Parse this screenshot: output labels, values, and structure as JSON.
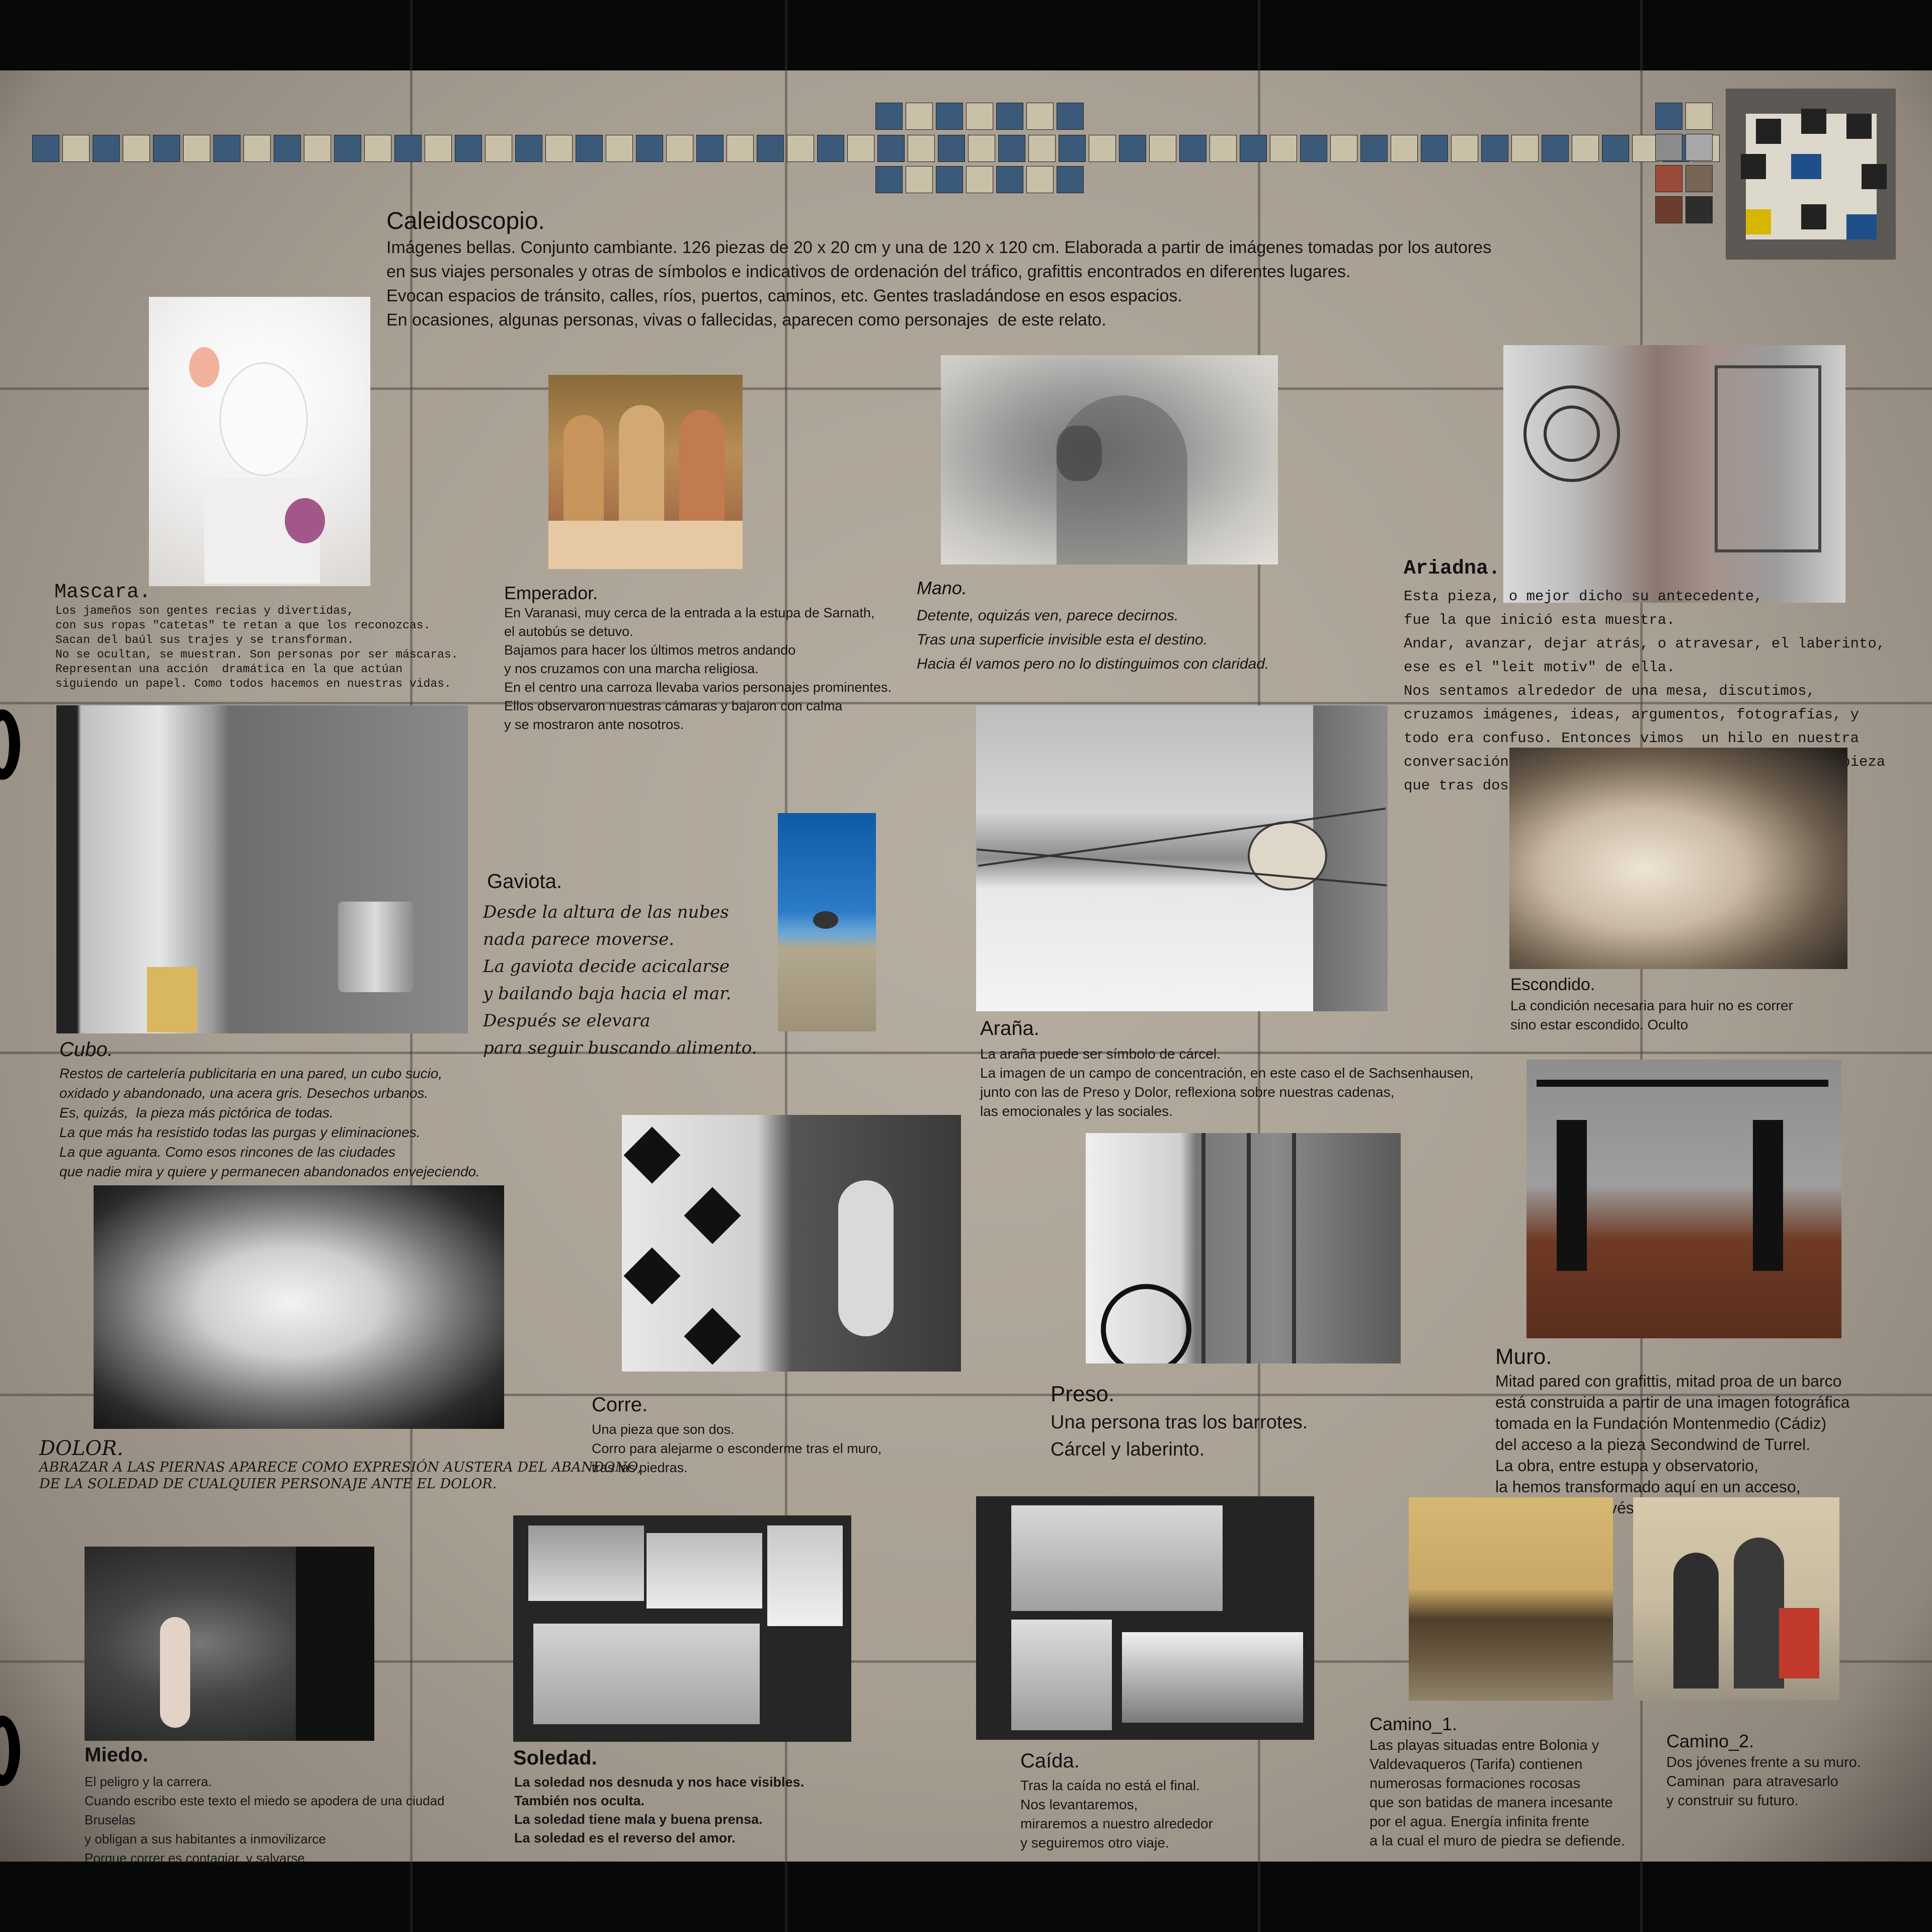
{
  "caleidoscopio": {
    "title": "Caleidoscopio.",
    "lines": [
      "Imágenes bellas. Conjunto cambiante. 126 piezas de 20 x 20 cm y una de 120 x 120 cm. Elaborada a partir de imágenes tomadas por los autores",
      "en sus viajes personales y otras de símbolos e indicativos de ordenación del tráfico, grafittis encontrados en diferentes lugares.",
      "Evocan espacios de tránsito, calles, ríos, puertos, caminos, etc. Gentes trasladándose en esos espacios.",
      "En ocasiones, algunas personas, vivas o fallecidas, aparecen como personajes  de este relato."
    ]
  },
  "mascara": {
    "title": "Mascara.",
    "text": "Los jameños son gentes recias y divertidas,\ncon sus ropas \"catetas\" te retan a que los reconozcas.\nSacan del baúl sus trajes y se transforman.\nNo se ocultan, se muestran. Son personas por ser máscaras.\nRepresentan una acción  dramática en la que actúan\nsiguiendo un papel. Como todos hacemos en nuestras vidas."
  },
  "emperador": {
    "title": "Emperador.",
    "text": "En Varanasi, muy cerca de la entrada a la estupa de Sarnath,\nel autobús se detuvo.\nBajamos para hacer los últimos metros andando\ny nos cruzamos con una marcha religiosa.\nEn el centro una carroza llevaba varios personajes prominentes.\nEllos observaron nuestras cámaras y bajaron con calma\ny se mostraron ante nosotros."
  },
  "mano": {
    "title": "Mano.",
    "text": "Detente, oquizás ven, parece decirnos.\nTras una superficie invisible esta el destino.\nHacia él vamos pero no lo distinguimos con claridad."
  },
  "ariadna": {
    "title": "Ariadna.",
    "text": "Esta pieza, o mejor dicho su antecedente,\nfue la que inició esta muestra.\nAndar, avanzar, dejar atrás, o atravesar, el laberinto,\nese es el \"leit motiv\" de ella.\nNos sentamos alrededor de una mesa, discutimos,\ncruzamos imágenes, ideas, argumentos, fotografías, y\ntodo era confuso. Entonces vimos  un hilo en nuestra\nconversación y empezamos a tirar de él. Salió una pieza\nque tras dos o tres transformaciones acabó como ve."
  },
  "gaviota": {
    "title": "Gaviota.",
    "text": "Desde la altura de las nubes\nnada parece moverse.\nLa gaviota decide acicalarse\ny bailando baja hacia el mar.\nDespués se elevara\npara seguir buscando alimento."
  },
  "cubo": {
    "title": "Cubo.",
    "text": "Restos de cartelería publicitaria en una pared, un cubo sucio,\noxidado y abandonado, una acera gris. Desechos urbanos.\nEs, quizás,  la pieza más pictórica de todas.\nLa que más ha resistido todas las purgas y eliminaciones.\nLa que aguanta. Como esos rincones de las ciudades\nque nadie mira y quiere y permanecen abandonados envejeciendo."
  },
  "arana": {
    "title": "Araña.",
    "text": "La araña puede ser símbolo de cárcel.\nLa imagen de un campo de concentración, en este caso el de Sachsenhausen,\njunto con las de Preso y Dolor, reflexiona sobre nuestras cadenas,\nlas emocionales y las sociales."
  },
  "escondido": {
    "title": "Escondido.",
    "text": "La condición necesaria para huir no es correr\nsino estar escondido. Oculto"
  },
  "dolor": {
    "title": "DOLOR.",
    "text": "ABRAZAR A LAS PIERNAS APARECE COMO EXPRESIÓN AUSTERA DEL ABANDONO,\nDE LA SOLEDAD DE CUALQUIER PERSONAJE ANTE EL DOLOR."
  },
  "corre": {
    "title": "Corre.",
    "text": "Una pieza que son dos.\nCorro para alejarme o esconderme tras el muro,\ntras las piedras."
  },
  "preso": {
    "title": "Preso.",
    "text": "Una persona tras los barrotes.\nCárcel y laberinto."
  },
  "muro": {
    "title": "Muro.",
    "text": "Mitad pared con grafittis, mitad proa de un barco\nestá construida a partir de una imagen fotográfica\ntomada en la Fundación Montenmedio (Cádiz)\ndel acceso a la pieza Secondwind de Turrel.\nLa obra, entre estupa y observatorio,\nla hemos transformado aquí en un acceso,\nuna puerta a través del muro"
  },
  "miedo": {
    "title": "Miedo.",
    "text": "El peligro y la carrera.\nCuando escribo este texto el miedo se apodera de una ciudad\nBruselas\ny obligan a sus habitantes a inmovilizarce\nPorque correr es contagiar, y salvarse"
  },
  "soledad": {
    "title": "Soledad.",
    "text": "La soledad nos desnuda y nos hace visibles.\nTambién nos oculta.\nLa soledad tiene mala y buena prensa.\nLa soledad es el reverso del amor."
  },
  "caida": {
    "title": "Caída.",
    "text": "Tras la caída no está el final.\nNos levantaremos,\nmiraremos a nuestro alrededor\ny seguiremos otro viaje."
  },
  "camino1": {
    "title": "Camino_1.",
    "text": "Las playas situadas entre Bolonia y\nValdevaqueros (Tarifa) contienen\nnumerosas formaciones rocosas\nque son batidas de manera incesante\npor el agua. Energía infinita frente\na la cual el muro de piedra se defiende."
  },
  "camino2": {
    "title": "Camino_2.",
    "text": "Dos jóvenes frente a su muro.\nCaminan  para atravesarlo\ny construir su futuro."
  },
  "colors": {
    "background": "#a89f93",
    "frame": "#080808",
    "grid": "#3c3732"
  }
}
